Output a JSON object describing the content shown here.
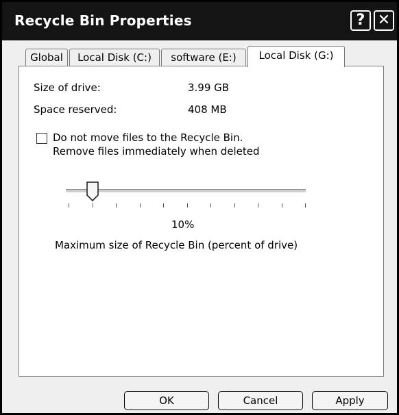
{
  "window": {
    "title": "Recycle Bin Properties",
    "help_glyph": "?",
    "close_glyph": "✕"
  },
  "tabs": [
    {
      "label": "Global"
    },
    {
      "label": "Local Disk (C:)"
    },
    {
      "label": "software (E:)"
    },
    {
      "label": "Local Disk (G:)"
    }
  ],
  "active_tab": "Local Disk (G:)",
  "drive": {
    "size_label": "Size of drive:",
    "size_value": "3.99 GB",
    "reserved_label": "Space reserved:",
    "reserved_value": "408 MB"
  },
  "option": {
    "checked": false,
    "line1": "Do not move files to the Recycle Bin.",
    "line2": "Remove files immediately when deleted"
  },
  "slider": {
    "value_percent": 10,
    "value_text": "10%",
    "caption": "Maximum size of Recycle Bin (percent of drive)"
  },
  "buttons": {
    "ok": "OK",
    "cancel": "Cancel",
    "apply": "Apply"
  }
}
